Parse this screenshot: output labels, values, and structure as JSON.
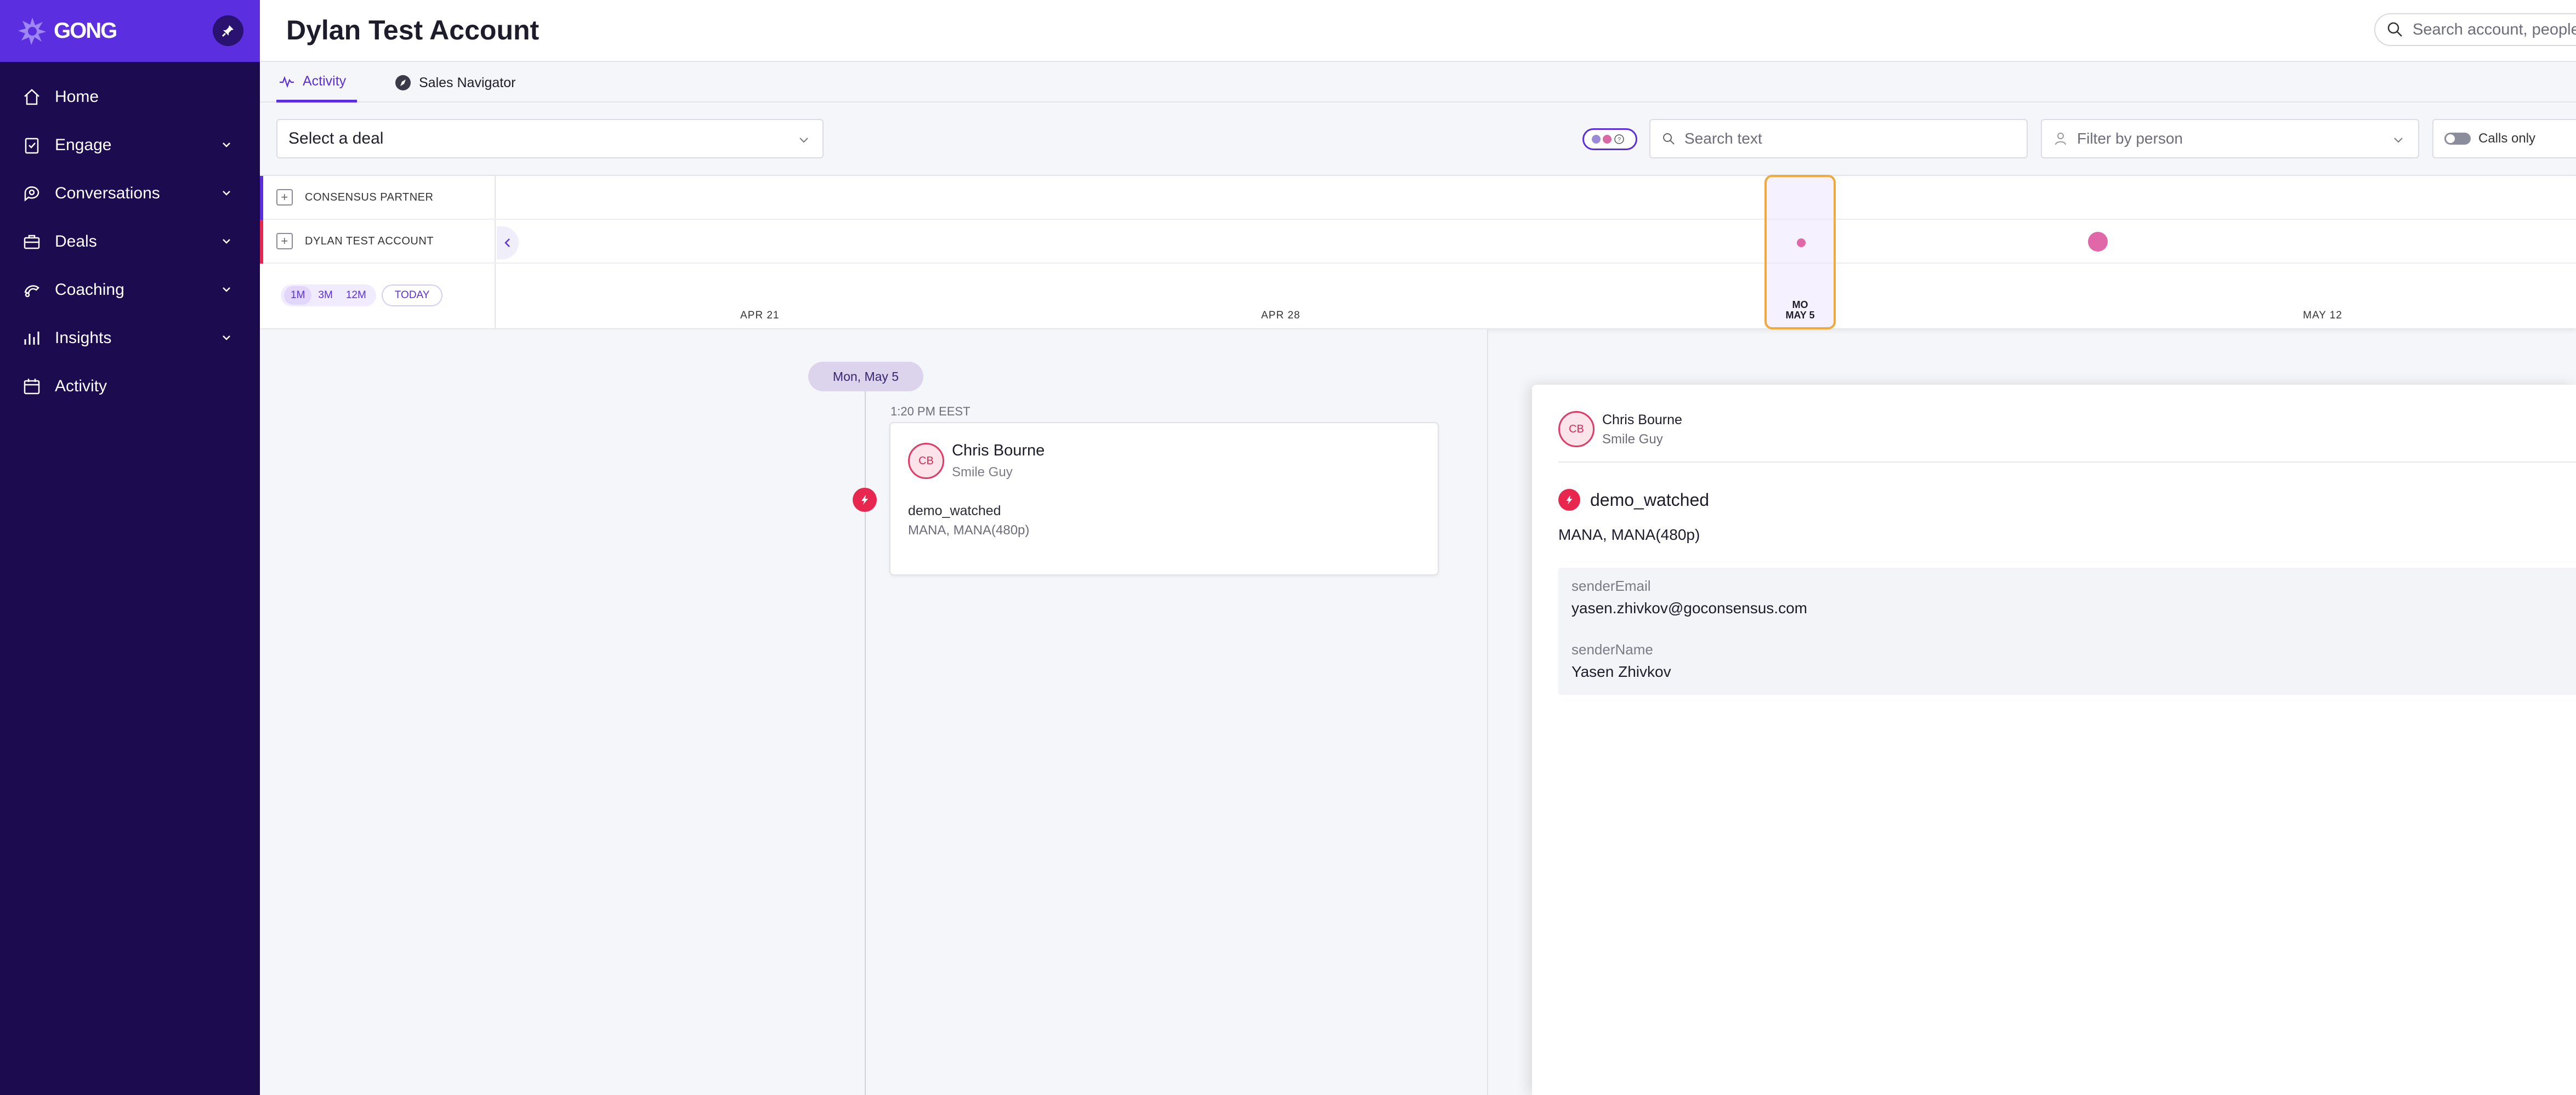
{
  "app": {
    "brand": "GONG",
    "accent": "#5b2ee0",
    "sidebar_bg": "#1d0b4f"
  },
  "sidebar": {
    "items": [
      {
        "label": "Home",
        "icon": "home-icon",
        "expandable": false
      },
      {
        "label": "Engage",
        "icon": "engage-icon",
        "expandable": true
      },
      {
        "label": "Conversations",
        "icon": "conversations-icon",
        "expandable": true
      },
      {
        "label": "Deals",
        "icon": "briefcase-icon",
        "expandable": true
      },
      {
        "label": "Coaching",
        "icon": "coaching-icon",
        "expandable": true
      },
      {
        "label": "Insights",
        "icon": "insights-icon",
        "expandable": true
      },
      {
        "label": "Activity",
        "icon": "calendar-icon",
        "expandable": false
      }
    ]
  },
  "header": {
    "title": "Dylan Test Account",
    "search_placeholder": "Search account, people"
  },
  "tabs": [
    {
      "label": "Activity",
      "icon": "activity-icon",
      "active": true
    },
    {
      "label": "Sales Navigator",
      "icon": "compass-icon",
      "active": false
    }
  ],
  "filters": {
    "deal_select": "Select a deal",
    "text_search_placeholder": "Search text",
    "person_filter_placeholder": "Filter by person",
    "calls_only_label": "Calls only",
    "calls_only_enabled": false
  },
  "timeline": {
    "rows": [
      {
        "label": "CONSENSUS PARTNER",
        "color": "#5b2ee0"
      },
      {
        "label": "DYLAN TEST ACCOUNT",
        "color": "#e8274f"
      }
    ],
    "range_buttons": [
      "1M",
      "3M",
      "12M"
    ],
    "today_label": "TODAY",
    "dates": [
      "APR 21",
      "APR 28",
      "MAY 12"
    ],
    "selected_date_day": "MO",
    "selected_date": "MAY 5"
  },
  "activity": {
    "day_label": "Mon, May 5",
    "time": "1:20 PM EEST",
    "card": {
      "initials": "CB",
      "name": "Chris Bourne",
      "role": "Smile Guy",
      "event": "demo_watched",
      "detail": "MANA, MANA(480p)"
    }
  },
  "detail_panel": {
    "initials": "CB",
    "name": "Chris Bourne",
    "role": "Smile Guy",
    "event_title": "demo_watched",
    "event_sub": "MANA, MANA(480p)",
    "fields": [
      {
        "key": "senderEmail",
        "value": "yasen.zhivkov@goconsensus.com"
      },
      {
        "key": "senderName",
        "value": "Yasen Zhivkov"
      }
    ]
  }
}
